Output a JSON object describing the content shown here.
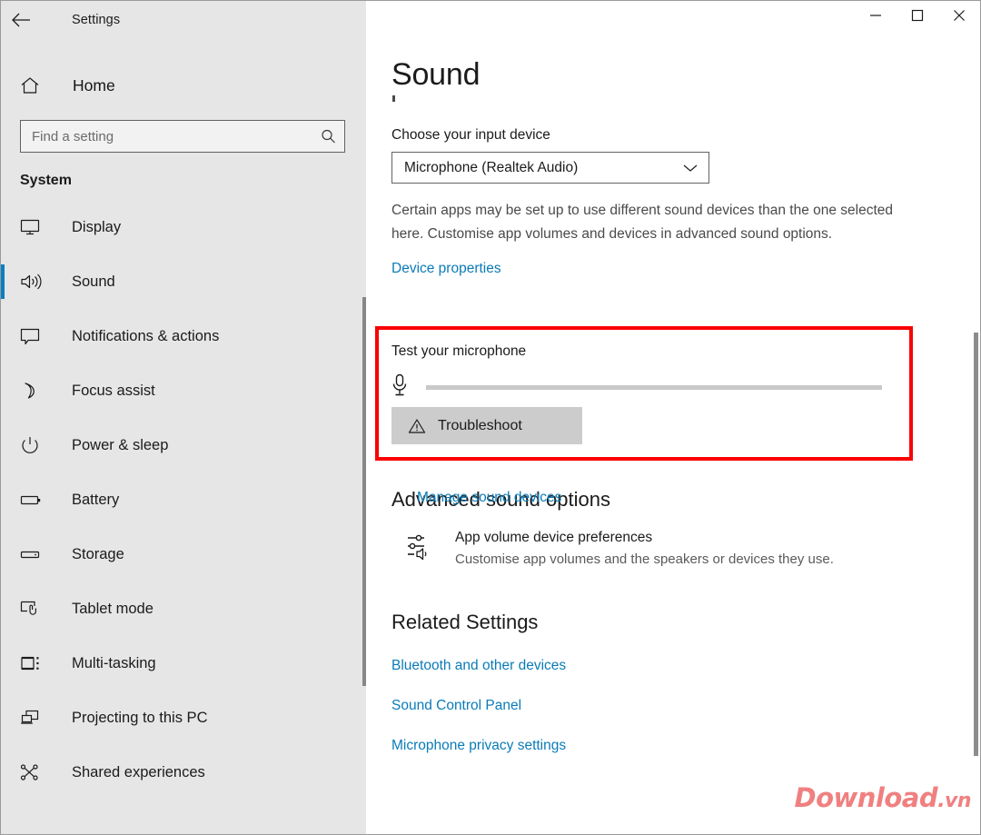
{
  "window": {
    "title": "Settings",
    "back_icon": "back-arrow-icon",
    "controls": [
      {
        "name": "minimize",
        "label": "—"
      },
      {
        "name": "maximize",
        "label": "□"
      },
      {
        "name": "close",
        "label": "✕"
      }
    ]
  },
  "sidebar": {
    "home_label": "Home",
    "home_icon": "home-icon",
    "search": {
      "placeholder": "Find a setting",
      "value": "",
      "icon": "search-icon"
    },
    "group_title": "System",
    "selected_index": 1,
    "items": [
      {
        "label": "Display",
        "icon": "monitor-icon"
      },
      {
        "label": "Sound",
        "icon": "speaker-icon"
      },
      {
        "label": "Notifications & actions",
        "icon": "comment-icon"
      },
      {
        "label": "Focus assist",
        "icon": "moon-icon"
      },
      {
        "label": "Power & sleep",
        "icon": "power-icon"
      },
      {
        "label": "Battery",
        "icon": "battery-icon"
      },
      {
        "label": "Storage",
        "icon": "drive-icon"
      },
      {
        "label": "Tablet mode",
        "icon": "tablet-touch-icon"
      },
      {
        "label": "Multi-tasking",
        "icon": "multitask-icon"
      },
      {
        "label": "Projecting to this PC",
        "icon": "projector-icon"
      },
      {
        "label": "Shared experiences",
        "icon": "share-nodes-icon"
      }
    ]
  },
  "main": {
    "page_title": "Sound",
    "input_section": {
      "label": "Choose your input device",
      "selected_device": "Microphone (Realtek Audio)",
      "dropdown_icon": "chevron-down-icon",
      "description": "Certain apps may be set up to use different sound devices than the one selected here. Customise app volumes and devices in advanced sound options.",
      "device_properties_link": "Device properties"
    },
    "test_section": {
      "label": "Test your microphone",
      "mic_icon": "microphone-icon",
      "meter_level_percent": 0,
      "troubleshoot_label": "Troubleshoot",
      "troubleshoot_icon": "warning-triangle-icon",
      "highlighted": true,
      "highlight_color": "#fb0000"
    },
    "manage_sound_devices_link": "Manage sound devices",
    "advanced": {
      "heading": "Advanced sound options",
      "item_title": "App volume  device preferences",
      "item_subtitle": "Customise app volumes and the speakers or devices they use.",
      "item_icon": "mixer-sliders-icon"
    },
    "related": {
      "heading": "Related Settings",
      "links": [
        "Bluetooth and other devices",
        "Sound Control Panel",
        "Microphone privacy settings"
      ]
    }
  },
  "watermark": {
    "text": "Download",
    "tld": ".vn",
    "color": "#f08080"
  },
  "theme": {
    "sidebar_bg": "#e6e6e6",
    "accent": "#0b7ec1",
    "link": "#0a7bb8",
    "highlight": "#fb0000"
  }
}
